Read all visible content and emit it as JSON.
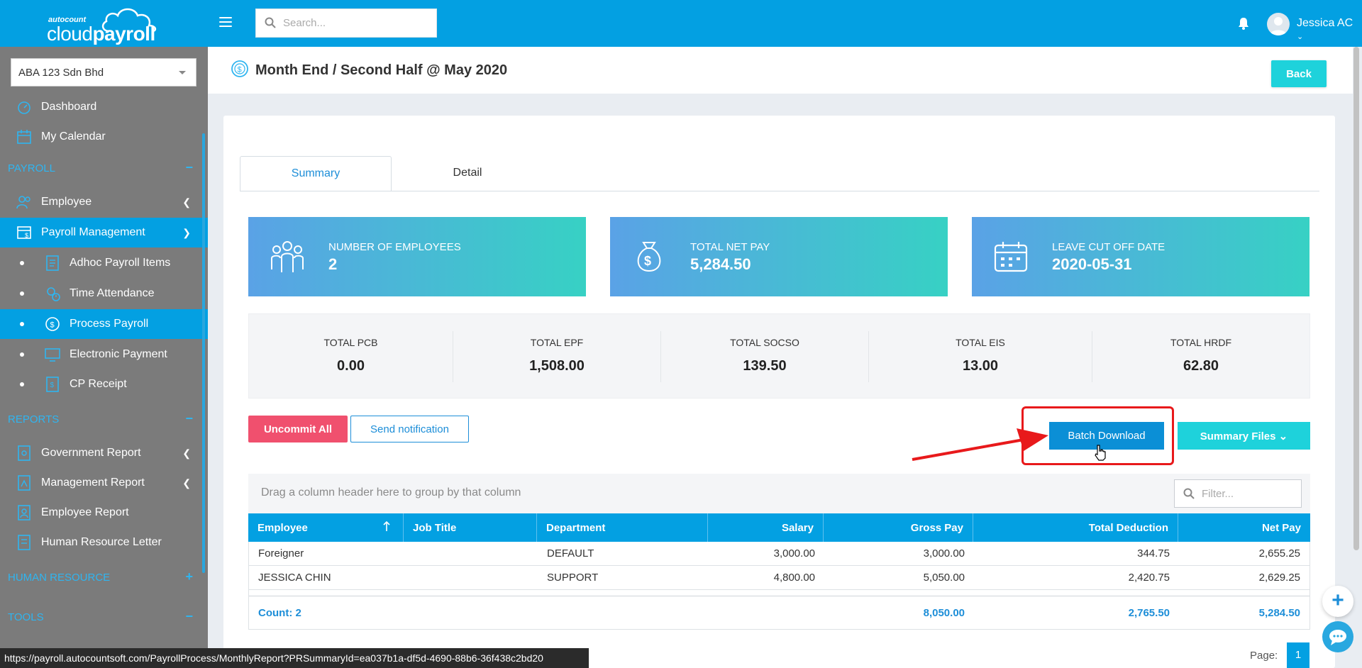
{
  "app": {
    "logo_small": "autocount",
    "logo_light": "cloud",
    "logo_bold": "payroll"
  },
  "topbar": {
    "search_placeholder": "Search...",
    "user_name": "Jessica AC"
  },
  "sidebar": {
    "company": "ABA 123 Sdn Bhd",
    "dashboard": "Dashboard",
    "calendar": "My Calendar",
    "section_payroll": "PAYROLL",
    "employee": "Employee",
    "payroll_management": "Payroll Management",
    "adhoc": "Adhoc Payroll Items",
    "time_attendance": "Time Attendance",
    "process_payroll": "Process Payroll",
    "electronic_payment": "Electronic Payment",
    "cp_receipt": "CP Receipt",
    "section_reports": "REPORTS",
    "government_report": "Government Report",
    "management_report": "Management Report",
    "employee_report": "Employee Report",
    "hr_letter": "Human Resource Letter",
    "section_hr": "HUMAN RESOURCE",
    "section_tools": "TOOLS",
    "minus": "−",
    "plus": "+"
  },
  "page": {
    "title": "Month End / Second Half @ May 2020",
    "back_label": "Back"
  },
  "tabs": {
    "summary": "Summary",
    "detail": "Detail"
  },
  "stats": {
    "employees_label": "NUMBER OF EMPLOYEES",
    "employees_value": "2",
    "netpay_label": "TOTAL NET PAY",
    "netpay_value": "5,284.50",
    "leave_label": "LEAVE CUT OFF DATE",
    "leave_value": "2020-05-31"
  },
  "totals": {
    "pcb_label": "TOTAL PCB",
    "pcb_value": "0.00",
    "epf_label": "TOTAL EPF",
    "epf_value": "1,508.00",
    "socso_label": "TOTAL SOCSO",
    "socso_value": "139.50",
    "eis_label": "TOTAL EIS",
    "eis_value": "13.00",
    "hrdf_label": "TOTAL HRDF",
    "hrdf_value": "62.80"
  },
  "actions": {
    "uncommit": "Uncommit All",
    "notify": "Send notification",
    "batch_download": "Batch Download",
    "summary_files": "Summary Files"
  },
  "grid": {
    "group_hint": "Drag a column header here to group by that column",
    "filter_placeholder": "Filter...",
    "columns": [
      "Employee",
      "Job Title",
      "Department",
      "Salary",
      "Gross Pay",
      "Total Deduction",
      "Net Pay"
    ],
    "rows": [
      [
        "Foreigner",
        "",
        "DEFAULT",
        "3,000.00",
        "3,000.00",
        "344.75",
        "2,655.25"
      ],
      [
        "JESSICA CHIN",
        "",
        "SUPPORT",
        "4,800.00",
        "5,050.00",
        "2,420.75",
        "2,629.25"
      ]
    ],
    "footer": {
      "count": "Count: 2",
      "gross_total": "8,050.00",
      "deduction_total": "2,765.50",
      "net_total": "5,284.50"
    }
  },
  "pager": {
    "label": "Page:",
    "current": "1"
  },
  "statusbar": {
    "url": "https://payroll.autocountsoft.com/PayrollProcess/MonthlyReport?PRSummaryId=ea037b1a-df5d-4690-88b6-36f438c2bd20"
  },
  "colors": {
    "primary": "#03a0e2",
    "teal": "#1ed2db",
    "danger": "#f0506e",
    "sidebar": "#7b7b7b",
    "annotation_red": "#e8191b"
  }
}
